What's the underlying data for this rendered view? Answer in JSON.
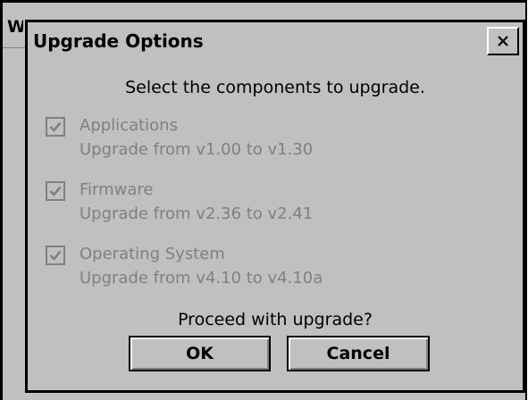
{
  "parent_window": {
    "title": "W"
  },
  "dialog": {
    "title": "Upgrade Options",
    "close_symbol": "×",
    "prompt": "Select the components to upgrade.",
    "options": [
      {
        "name": "Applications",
        "detail": "Upgrade from v1.00 to v1.30",
        "checked": true,
        "enabled": false
      },
      {
        "name": "Firmware",
        "detail": "Upgrade from v2.36 to v2.41",
        "checked": true,
        "enabled": false
      },
      {
        "name": "Operating System",
        "detail": "Upgrade from v4.10 to v4.10a",
        "checked": true,
        "enabled": false
      }
    ],
    "question": "Proceed with upgrade?",
    "ok_label": "OK",
    "cancel_label": "Cancel"
  },
  "colors": {
    "face": "#c0c0c0",
    "disabled_text": "#808080",
    "text": "#000000"
  },
  "icons": {
    "close": "close-icon",
    "check": "checkmark-icon"
  }
}
